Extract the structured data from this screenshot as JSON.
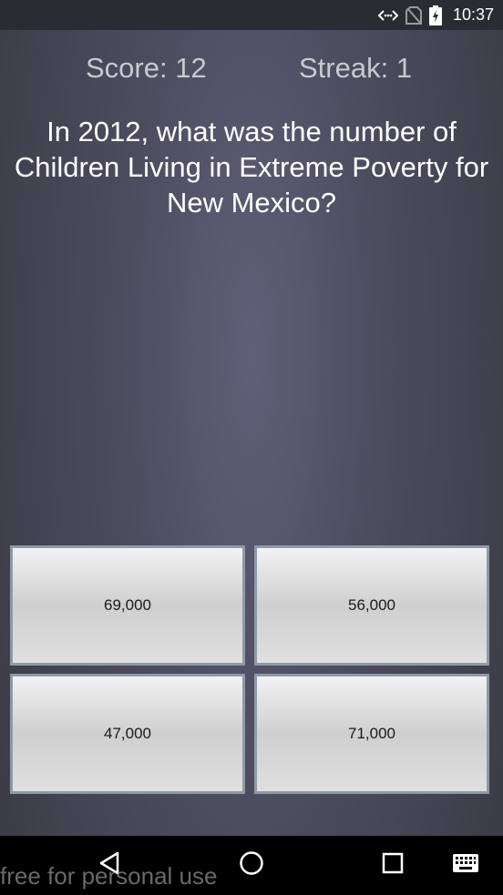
{
  "status_bar": {
    "time": "10:37",
    "icons": [
      "data-sync-icon",
      "no-sim-icon",
      "battery-charging-icon"
    ]
  },
  "game": {
    "score_label": "Score: 12",
    "streak_label": "Streak: 1",
    "question": "In 2012, what was the number of Children Living in Extreme Poverty for New Mexico?",
    "answers": [
      "69,000",
      "56,000",
      "47,000",
      "71,000"
    ]
  },
  "nav_bar": {
    "icons": [
      "back-icon",
      "home-icon",
      "recents-icon",
      "keyboard-icon"
    ]
  },
  "watermark": "free for personal use",
  "colors": {
    "background": "#4d4d60",
    "score_text": "#c9c9cf",
    "question_text": "#ffffff",
    "button_border": "#8f9aa6"
  }
}
